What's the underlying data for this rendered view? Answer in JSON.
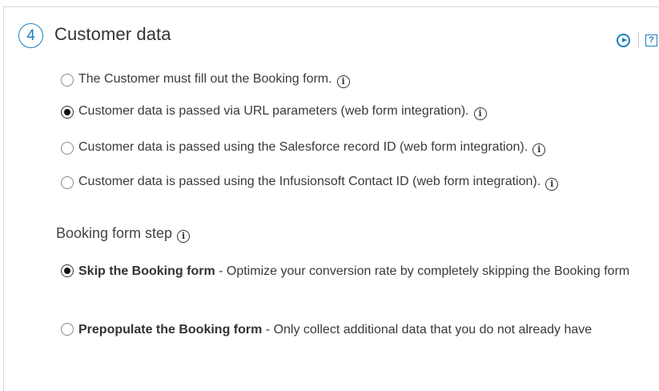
{
  "section": {
    "step_number": "4",
    "title": "Customer data"
  },
  "icons": {
    "play": "play-circle-icon",
    "help": "help-icon",
    "info": "info-icon",
    "info_glyph": "i",
    "help_glyph": "?"
  },
  "customer_data_options": [
    {
      "label": "The Customer must fill out the Booking form.",
      "checked": false
    },
    {
      "label": "Customer data is passed via URL parameters (web form integration).",
      "checked": true
    },
    {
      "label": "Customer data is passed using the Salesforce record ID (web form integration).",
      "checked": false
    },
    {
      "label": "Customer data is passed using the Infusionsoft Contact ID (web form integration).",
      "checked": false
    }
  ],
  "booking_form_step": {
    "heading": "Booking form step",
    "options": [
      {
        "title": "Skip the Booking form",
        "description": " - Optimize your conversion rate by completely skipping the Booking form",
        "checked": true
      },
      {
        "title": "Prepopulate the Booking form",
        "description": " - Only collect additional data that you do not already have",
        "checked": false
      }
    ]
  },
  "colors": {
    "accent": "#1a7fc1",
    "text": "#333333"
  }
}
